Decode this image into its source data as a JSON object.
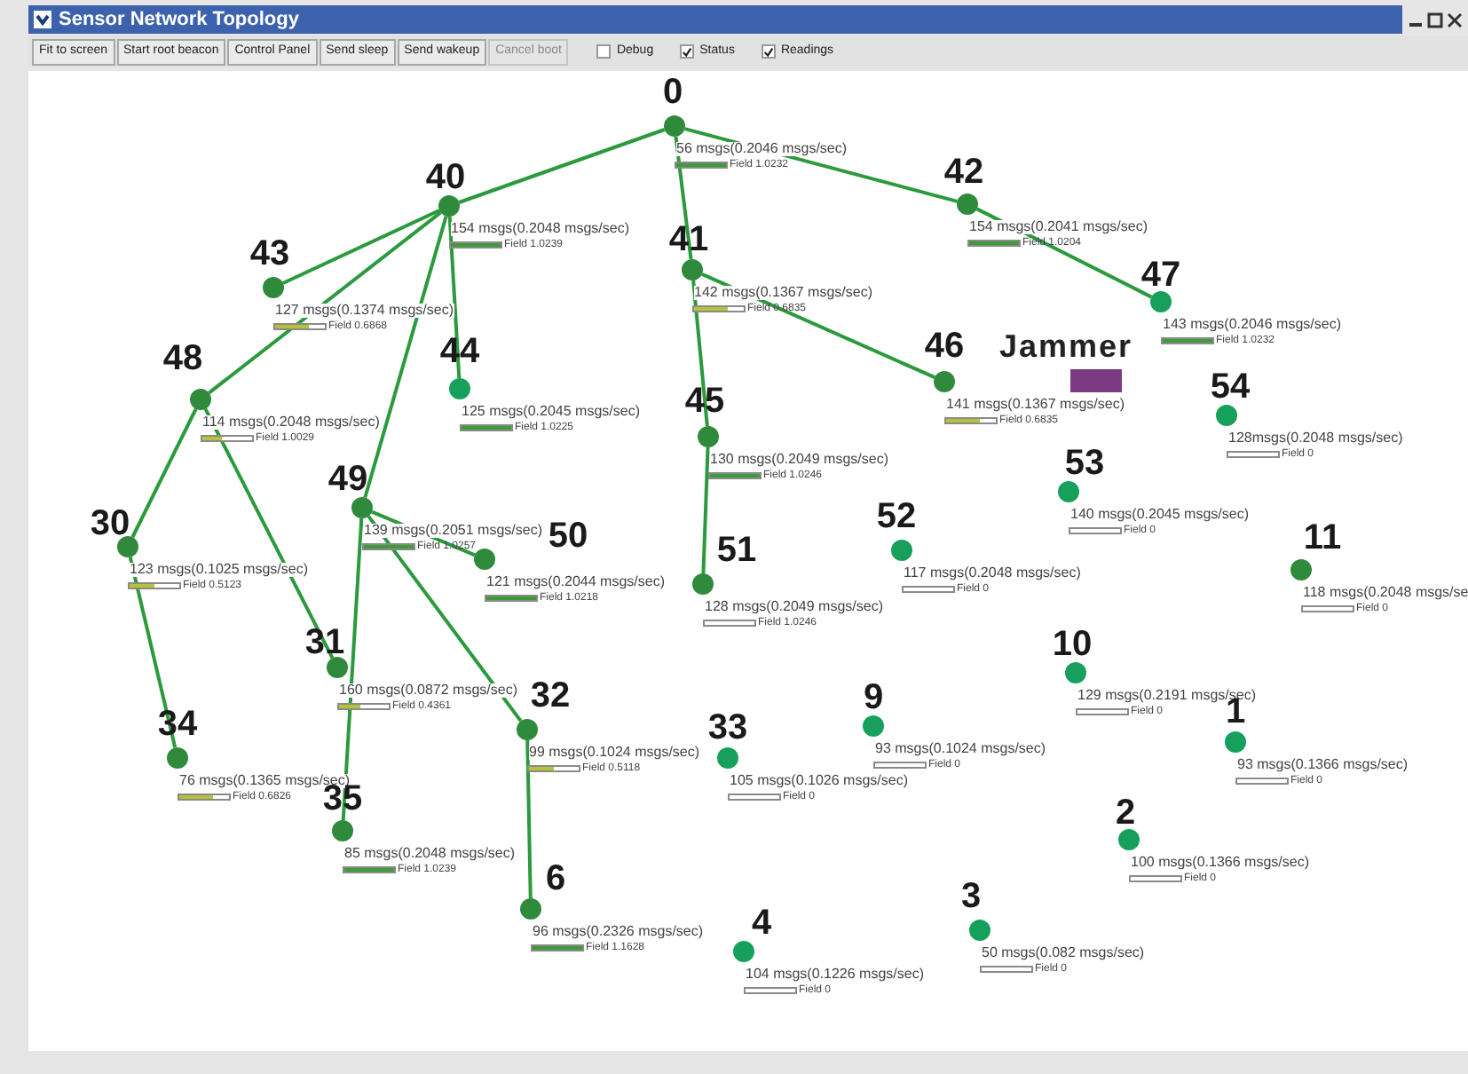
{
  "window": {
    "title": "Sensor Network Topology"
  },
  "toolbar": {
    "buttons": [
      {
        "label": "Fit to screen",
        "disabled": false
      },
      {
        "label": "Start root beacon",
        "disabled": false
      },
      {
        "label": "Control Panel",
        "disabled": false
      },
      {
        "label": "Send sleep",
        "disabled": false
      },
      {
        "label": "Send wakeup",
        "disabled": false
      },
      {
        "label": "Cancel boot",
        "disabled": true
      }
    ],
    "checkboxes": [
      {
        "label": "Debug",
        "checked": false
      },
      {
        "label": "Status",
        "checked": true
      },
      {
        "label": "Readings",
        "checked": true
      }
    ]
  },
  "topology": {
    "tree": [
      {
        "id": "0",
        "color": "#2f8a3c",
        "reading": "56 msgs(0.2046 msgs/sec)",
        "field": "Field 1.0232",
        "level": 1,
        "children": [
          {
            "id": "40",
            "color": "#2f8a3c",
            "reading": "154 msgs(0.2048 msgs/sec)",
            "field": "Field 1.0239",
            "level": 1,
            "children": [
              {
                "id": "43",
                "color": "#2f8a3c",
                "reading": "127 msgs(0.1374 msgs/sec)",
                "field": "Field 0.6868",
                "level": 0.69
              },
              {
                "id": "44",
                "color": "#17a05c",
                "reading": "125 msgs(0.2045 msgs/sec)",
                "field": "Field 1.0225",
                "level": 1
              },
              {
                "id": "48",
                "color": "#2f8a3c",
                "reading": "114 msgs(0.2048 msgs/sec)",
                "field": "Field 1.0029",
                "level": 0.4,
                "children": [
                  {
                    "id": "30",
                    "color": "#2f8a3c",
                    "reading": "123 msgs(0.1025 msgs/sec)",
                    "field": "Field 0.5123",
                    "level": 0.51,
                    "children": [
                      {
                        "id": "34",
                        "color": "#2f8a3c",
                        "reading": "76 msgs(0.1365 msgs/sec)",
                        "field": "Field 0.6826",
                        "level": 0.68
                      }
                    ]
                  },
                  {
                    "id": "31",
                    "color": "#2f8a3c",
                    "reading": "160 msgs(0.0872 msgs/sec)",
                    "field": "Field 0.4361",
                    "level": 0.44
                  }
                ]
              },
              {
                "id": "49",
                "color": "#2f8a3c",
                "reading": "139 msgs(0.2051 msgs/sec)",
                "field": "Field 1.0257",
                "level": 1,
                "children": [
                  {
                    "id": "50",
                    "color": "#2f8a3c",
                    "reading": "121 msgs(0.2044 msgs/sec)",
                    "field": "Field 1.0218",
                    "level": 1
                  },
                  {
                    "id": "35",
                    "color": "#2f8a3c",
                    "reading": "85 msgs(0.2048 msgs/sec)",
                    "field": "Field 1.0239",
                    "level": 1
                  },
                  {
                    "id": "32",
                    "color": "#2f8a3c",
                    "reading": "99 msgs(0.1024 msgs/sec)",
                    "field": "Field 0.5118",
                    "level": 0.51,
                    "children": [
                      {
                        "id": "6",
                        "color": "#2f8a3c",
                        "reading": "96 msgs(0.2326 msgs/sec)",
                        "field": "Field 1.1628",
                        "level": 1
                      }
                    ]
                  }
                ]
              }
            ]
          },
          {
            "id": "41",
            "color": "#2f8a3c",
            "reading": "142 msgs(0.1367 msgs/sec)",
            "field": "Field 0.6835",
            "level": 0.68,
            "children": [
              {
                "id": "45",
                "color": "#2f8a3c",
                "reading": "130 msgs(0.2049 msgs/sec)",
                "field": "Field 1.0246",
                "level": 1,
                "children": [
                  {
                    "id": "51",
                    "color": "#2f8a3c",
                    "reading": "128 msgs(0.2049 msgs/sec)",
                    "field": "Field 1.0246",
                    "level": 0
                  }
                ]
              },
              {
                "id": "46",
                "color": "#2f8a3c",
                "reading": "141 msgs(0.1367 msgs/sec)",
                "field": "Field 0.6835",
                "level": 0.68
              }
            ]
          },
          {
            "id": "42",
            "color": "#2f8a3c",
            "reading": "154 msgs(0.2041 msgs/sec)",
            "field": "Field 1.0204",
            "level": 1,
            "children": [
              {
                "id": "47",
                "color": "#17a05c",
                "reading": "143 msgs(0.2046 msgs/sec)",
                "field": "Field 1.0232",
                "level": 1
              }
            ]
          }
        ]
      }
    ],
    "unconnected": [
      {
        "id": "54",
        "color": "#17a05c",
        "reading": "128msgs(0.2048 msgs/sec)",
        "field": "Field 0",
        "level": 0
      },
      {
        "id": "53",
        "color": "#17a05c",
        "reading": "140 msgs(0.2045 msgs/sec)",
        "field": "Field 0",
        "level": 0
      },
      {
        "id": "52",
        "color": "#17a05c",
        "reading": "117 msgs(0.2048 msgs/sec)",
        "field": "Field 0",
        "level": 0
      },
      {
        "id": "11",
        "color": "#2f8a3c",
        "reading": "118 msgs(0.2048 msgs/se",
        "field": "Field 0",
        "level": 0
      },
      {
        "id": "10",
        "color": "#17a05c",
        "reading": "129 msgs(0.2191 msgs/sec)",
        "field": "Field 0",
        "level": 0
      },
      {
        "id": "9",
        "color": "#17a05c",
        "reading": "93 msgs(0.1024 msgs/sec)",
        "field": "Field 0",
        "level": 0
      },
      {
        "id": "33",
        "color": "#17a05c",
        "reading": "105 msgs(0.1026 msgs/sec)",
        "field": "Field 0",
        "level": 0
      },
      {
        "id": "1",
        "color": "#17a05c",
        "reading": "93 msgs(0.1366 msgs/sec)",
        "field": "Field 0",
        "level": 0
      },
      {
        "id": "2",
        "color": "#17a05c",
        "reading": "100 msgs(0.1366 msgs/sec)",
        "field": "Field 0",
        "level": 0
      },
      {
        "id": "3",
        "color": "#17a05c",
        "reading": "50 msgs(0.082 msgs/sec)",
        "field": "Field 0",
        "level": 0
      },
      {
        "id": "4",
        "color": "#17a05c",
        "reading": "104 msgs(0.1226 msgs/sec)",
        "field": "Field 0",
        "level": 0
      }
    ],
    "jammer": {
      "label": "Jammer"
    }
  }
}
